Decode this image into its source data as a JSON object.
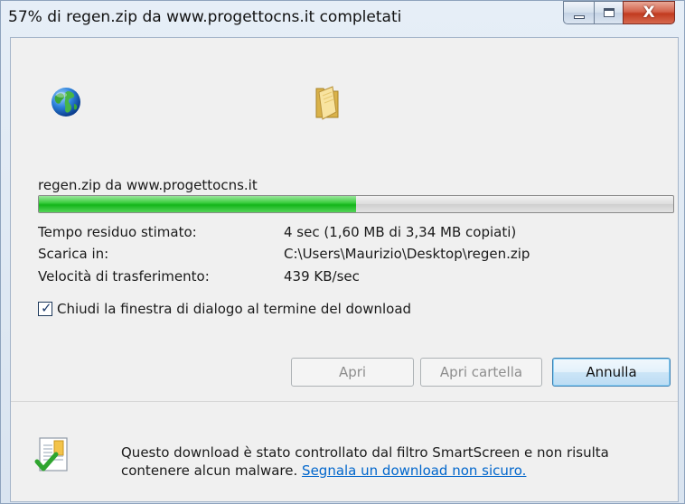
{
  "window": {
    "title": "57% di regen.zip da www.progettocns.it completati",
    "close_glyph": "X"
  },
  "icons": {
    "source": "globe-icon",
    "destination": "folder-icon",
    "security": "shield-check-icon"
  },
  "download": {
    "file_label": "regen.zip da www.progettocns.it",
    "progress_fraction": 0.5,
    "progress_color": "#13b51a"
  },
  "info": [
    {
      "label": "Tempo residuo stimato:",
      "value": "4 sec (1,60 MB di 3,34 MB copiati)"
    },
    {
      "label": "Scarica in:",
      "value": "C:\\Users\\Maurizio\\Desktop\\regen.zip"
    },
    {
      "label": "Velocità di trasferimento:",
      "value": "439 KB/sec"
    }
  ],
  "checkbox": {
    "label": "Chiudi la finestra di dialogo al termine del download",
    "checked": true
  },
  "buttons": {
    "open": "Apri",
    "open_folder": "Apri cartella",
    "cancel": "Annulla"
  },
  "footer": {
    "text": "Questo download è stato controllato dal filtro SmartScreen e non risulta contenere alcun malware.",
    "link": "Segnala un download non sicuro."
  }
}
